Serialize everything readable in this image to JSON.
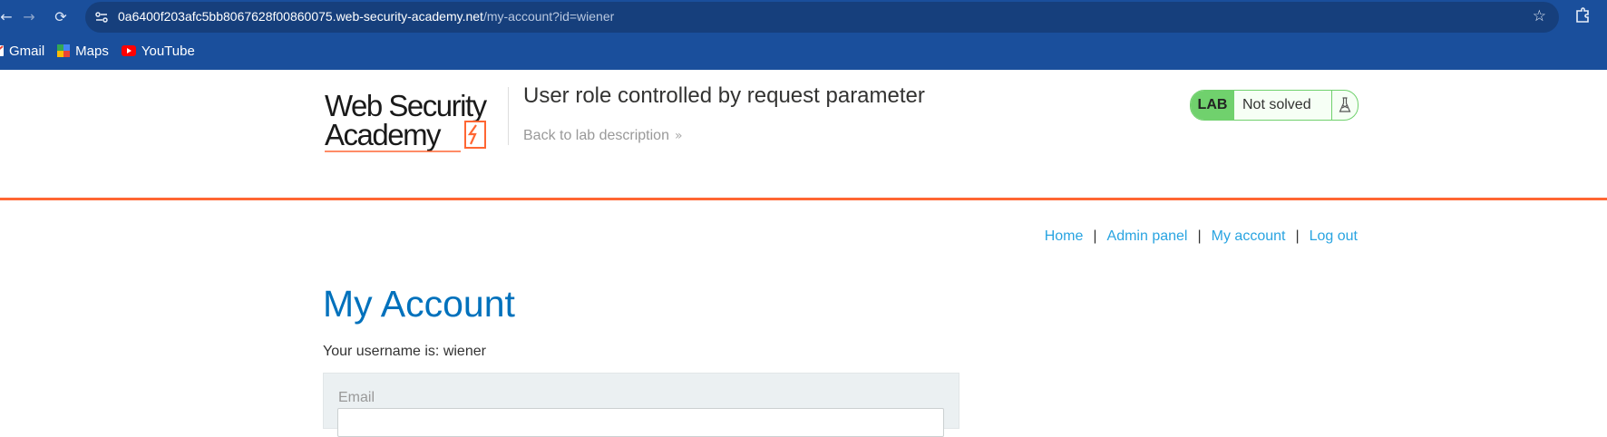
{
  "browser": {
    "url_host": "0a6400f203afc5bb8067628f00860075.web-security-academy.net",
    "url_path": "/my-account?id=wiener",
    "bookmarks": [
      {
        "label": "Gmail",
        "icon": "gmail-icon"
      },
      {
        "label": "Maps",
        "icon": "maps-icon"
      },
      {
        "label": "YouTube",
        "icon": "youtube-icon"
      }
    ]
  },
  "lab_header": {
    "logo_line1": "Web Security",
    "logo_line2": "Academy",
    "title": "User role controlled by request parameter",
    "back_link": "Back to lab description",
    "status_tag": "LAB",
    "status_text": "Not solved"
  },
  "site_nav": {
    "home": "Home",
    "admin": "Admin panel",
    "account": "My account",
    "logout": "Log out",
    "separator": "|"
  },
  "page": {
    "heading": "My Account",
    "username_text": "Your username is: wiener",
    "email_label": "Email"
  },
  "colors": {
    "chrome": "#1a4f9c",
    "accent_orange": "#ff6633",
    "link_blue": "#29a4e1",
    "heading_blue": "#0071bc",
    "lab_green": "#70d16d"
  }
}
